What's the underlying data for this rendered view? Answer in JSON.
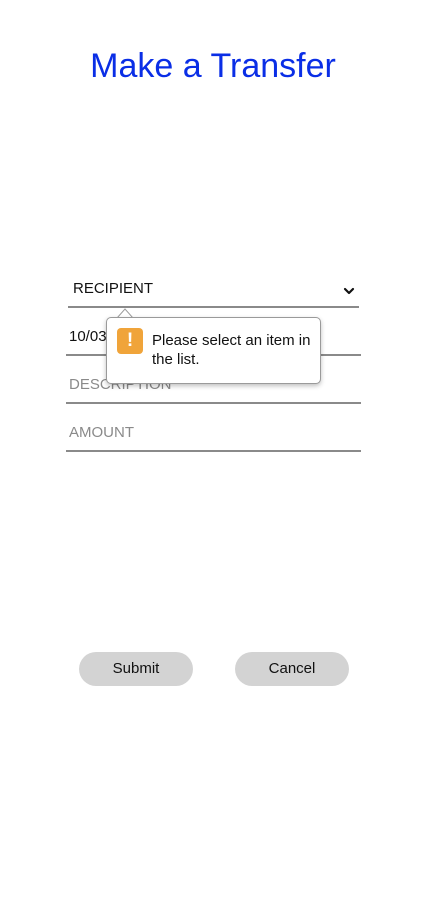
{
  "title": "Make a Transfer",
  "form": {
    "recipient": {
      "selected": "RECIPIENT"
    },
    "date": {
      "value": "10/03"
    },
    "description": {
      "placeholder": "DESCRIPTION"
    },
    "amount": {
      "placeholder": "AMOUNT"
    }
  },
  "validation_tooltip": {
    "icon": "warning-icon",
    "icon_glyph": "!",
    "message": "Please select an item in the list.",
    "icon_color": "#f0a43a"
  },
  "buttons": {
    "submit_label": "Submit",
    "cancel_label": "Cancel"
  },
  "colors": {
    "title": "#0a2ee6",
    "button_bg": "#d3d3d3"
  }
}
